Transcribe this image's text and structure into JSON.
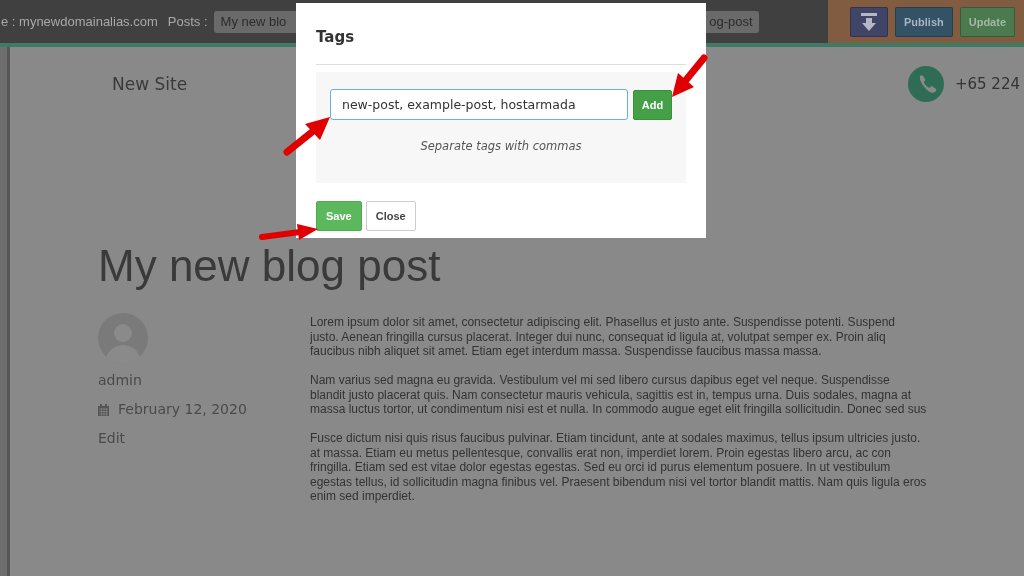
{
  "top_bar": {
    "site_label": "e : mynewdomainalias.com",
    "posts_label": "Posts :",
    "post_field": {
      "value_start": "My new blo",
      "value_end": "og-post"
    },
    "buttons": [
      {
        "kind": "icon"
      },
      {
        "kind": "publish",
        "label": "Publish"
      },
      {
        "kind": "update",
        "label": "Update"
      }
    ]
  },
  "header": {
    "site_title": "New Site",
    "phone": "+65 224"
  },
  "post": {
    "title": "My new blog post",
    "author": "admin",
    "date": "February 12, 2020",
    "edit_link": "Edit",
    "paragraphs": [
      [
        "Lorem ipsum dolor sit amet, consectetur adipiscing elit. Phasellus et justo ante. Suspendisse potenti. Suspend",
        "justo. Aenean fringilla cursus placerat. Integer dui nunc, consequat id ligula at, volutpat semper ex. Proin aliq",
        "faucibus nibh aliquet sit amet. Etiam eget interdum massa. Suspendisse faucibus massa massa."
      ],
      [
        "Nam varius sed magna eu gravida. Vestibulum vel mi sed libero cursus dapibus eget vel neque. Suspendisse",
        "blandit justo placerat quis. Nam consectetur mauris vehicula, sagittis est in, tempus urna. Duis sodales, magna at",
        "massa luctus tortor, ut condimentum nisi est et nulla. In commodo augue eget elit fringilla sollicitudin. Donec sed sus"
      ],
      [
        "Fusce dictum nisi quis risus faucibus pulvinar. Etiam tincidunt, ante at sodales maximus, tellus ipsum ultricies justo.",
        "at massa. Etiam eu metus pellentesque, convallis erat non, imperdiet lorem. Proin egestas libero arcu, ac con",
        "fringilla. Etiam sed est vitae dolor egestas egestas. Sed eu orci id purus elementum posuere. In ut vestibulum",
        "egestas tellus, id sollicitudin magna finibus vel. Praesent bibendum nisi vel tortor blandit mattis. Nam quis ligula eros",
        "enim sed imperdiet."
      ]
    ]
  },
  "tags_dialog": {
    "title": "Tags",
    "field": {
      "value": "new-post, example-post, hostarmada"
    },
    "add_button": "Add",
    "hint": "Separate tags with commas",
    "buttons": [
      {
        "kind": "primary",
        "label": "Save"
      },
      {
        "kind": "secondary",
        "label": "Close"
      }
    ]
  }
}
